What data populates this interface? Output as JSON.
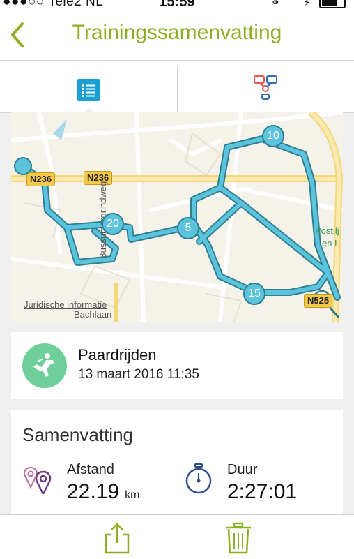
{
  "status_bar": {
    "carrier": "●●●○○ Tele2 NL",
    "time": "15:59"
  },
  "nav": {
    "title": "Trainingssamenvatting",
    "accent_color": "#8cb024"
  },
  "tabs": [
    {
      "icon": "list-icon",
      "selected": true
    },
    {
      "icon": "workflow-icon",
      "selected": false
    }
  ],
  "map": {
    "roads": [
      "N236",
      "N236",
      "N525"
    ],
    "place_names": [
      "Bussumergrindweg",
      "Bachlaan",
      "Postilj",
      "en L"
    ],
    "legal_link": "Juridische informatie",
    "markers": [
      "5",
      "10",
      "15",
      "20"
    ],
    "route_color": "#5bc4dc"
  },
  "activity": {
    "name": "Paardrijden",
    "date": "13 maart 2016 11:35",
    "icon": "horse-riding-icon",
    "icon_color": "#6ecf9a"
  },
  "summary": {
    "title": "Samenvatting",
    "distance_label": "Afstand",
    "distance_value": "22.19",
    "distance_unit": "km",
    "duration_label": "Duur",
    "duration_value": "2:27:01"
  },
  "toolbar": {
    "share_icon": "share-icon",
    "delete_icon": "trash-icon"
  }
}
